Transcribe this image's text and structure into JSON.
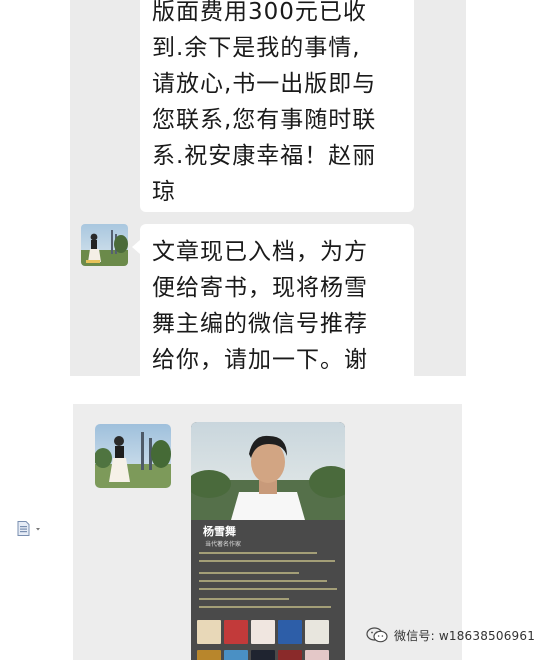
{
  "messages": {
    "first_text": "版面费用300元已收\n到.余下是我的事情,\n请放心,书一出版即与\n您联系,您有事随时联\n系.祝安康幸福！赵丽\n琼",
    "second_text": "文章现已入档，为方\n便给寄书，现将杨雪\n舞主编的微信号推荐\n给你，请加一下。谢"
  },
  "profile_card": {
    "name": "杨雪舞",
    "title": "当代著名作家"
  },
  "watermark": {
    "icon": "wechat-public-icon",
    "text": "微信号: w18638506961"
  },
  "side_icon": "document-icon"
}
